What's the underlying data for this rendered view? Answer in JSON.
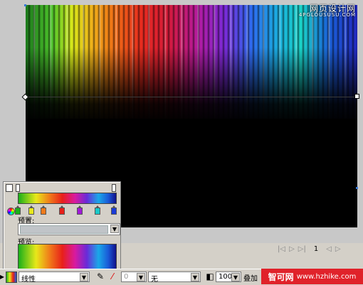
{
  "canvas": {
    "watermark_line1": "网页设计网",
    "watermark_line2": "4PGLOUSUSU.COM"
  },
  "timeline": {
    "frame_number": "1"
  },
  "gradient_panel": {
    "preset_label": "预置:",
    "preview_label": "预览:",
    "preset_value": ""
  },
  "toolbar": {
    "gradient_type": "线性",
    "disabled_value": "0",
    "texture": "无",
    "opacity": "100",
    "blend_mode": "叠加"
  },
  "brand": {
    "name": "智可网",
    "url": "www.hzhike.com"
  },
  "colors": {
    "accent": "#e0222a",
    "selection_handle": "#3a7ad8"
  }
}
